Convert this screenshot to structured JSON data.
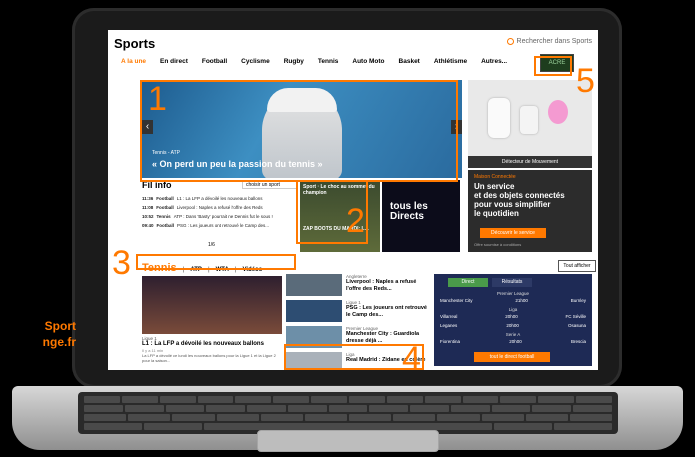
{
  "side_text": {
    "line1": "Sport",
    "line2": "nge.fr"
  },
  "page": {
    "title": "Sports",
    "search_label": "Rechercher dans Sports"
  },
  "nav": {
    "items": [
      "A la une",
      "En direct",
      "Football",
      "Cyclisme",
      "Rugby",
      "Tennis",
      "Auto Moto",
      "Basket",
      "Athlétisme",
      "Autres..."
    ],
    "logo_text": "ACRE"
  },
  "hero": {
    "kicker": "Tennis - ATP",
    "title": "« On perd un peu la passion du tennis »"
  },
  "ad_top": {
    "caption": "Détecteur de Mouvement"
  },
  "ad_promo": {
    "kicker": "Maison Connectée",
    "text": "Un service\net des objets connectés\npour vous simplifier\nle quotidien",
    "button": "Découvrir le service",
    "footer": "Offre soumise à conditions"
  },
  "fil_info": {
    "title": "Fil info",
    "select": "choisir un sport",
    "rows": [
      {
        "time": "11:36",
        "sport": "Football",
        "text": "L1 : La LFP a dévoilé les nouveaux ballons"
      },
      {
        "time": "11:08",
        "sport": "Football",
        "text": "Liverpool : Naples a refusé l'offre des Reds"
      },
      {
        "time": "10:52",
        "sport": "Tennis",
        "text": "ATP : Dans 'Basty' pourrait ne Dennis fut le sous !"
      },
      {
        "time": "09:40",
        "sport": "Football",
        "text": "PSG : Les joueurs ont retrouvé le Camp des..."
      }
    ],
    "pager": "1/6"
  },
  "videos": {
    "v1_top": "Sport · Le choc au sommet du champion",
    "v1_bottom": "ZAP BOOTS DU MARDI: L...",
    "v2": "tous les\nDirects"
  },
  "tennis_tabs": {
    "main": "Tennis",
    "items": [
      "ATP",
      "WTA",
      "Vidéos"
    ],
    "show_all": "Tout afficher"
  },
  "main_article": {
    "kicker": "Ligue 1",
    "title": "L1 : La LFP a dévoilé les nouveaux ballons",
    "meta": "Il y a 11 min",
    "body": "La LFP a dévoilé ce lundi les nouveaux ballons pour la Ligue 1 et la Ligue 2 pour la saison..."
  },
  "news": [
    {
      "kicker": "Angleterre",
      "title": "Liverpool : Naples a refusé l'offre des Reds..."
    },
    {
      "kicker": "Ligue 1",
      "title": "PSG : Les joueurs ont retrouvé le Camp des..."
    },
    {
      "kicker": "Premier League",
      "title": "Manchester City : Guardiola dresse déjà ..."
    },
    {
      "kicker": "Liga",
      "title": "Real Madrid : Zidane en colère"
    }
  ],
  "scores": {
    "tabs": [
      "Direct",
      "Résultats"
    ],
    "league1": "Premier League",
    "row1": {
      "home": "Manchester City",
      "score": "21h00",
      "away": "Burnley"
    },
    "league2": "Liga",
    "row2": {
      "home": "Villarreal",
      "score": "20h00",
      "away": "FC Séville"
    },
    "row3": {
      "home": "Leganes",
      "score": "20h00",
      "away": "Osasuna"
    },
    "league3": "Serie A",
    "row4": {
      "home": "Fiorentina",
      "score": "20h00",
      "away": "Brescia"
    },
    "button": "tout le direct football"
  },
  "annotations": {
    "n1": "1",
    "n2": "2",
    "n3": "3",
    "n4": "4",
    "n5": "5"
  },
  "colors": {
    "accent": "#ff7900",
    "scoreboard": "#1e2a55"
  }
}
